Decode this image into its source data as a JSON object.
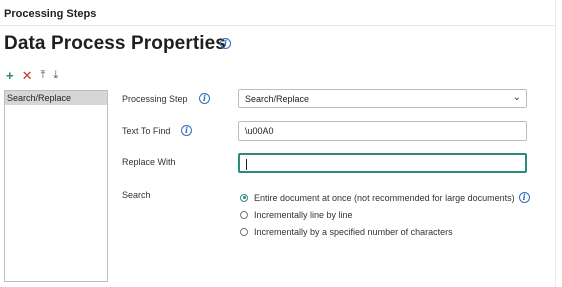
{
  "header": {
    "section_title": "Processing Steps",
    "page_title": "Data Process Properties"
  },
  "toolbar": {
    "add_glyph": "+",
    "delete_glyph": "✕",
    "move_up_glyph": "⤒",
    "move_down_glyph": "⤓"
  },
  "steps": {
    "items": [
      "Search/Replace"
    ],
    "selected": "Search/Replace"
  },
  "form": {
    "processing_step_label": "Processing Step",
    "processing_step_value": "Search/Replace",
    "text_to_find_label": "Text To Find",
    "text_to_find_value": "\\u00A0",
    "replace_with_label": "Replace With",
    "replace_with_value": "",
    "search_label": "Search",
    "search_options": [
      "Entire document at once (not recommended for large documents)",
      "Incrementally line by line",
      "Incrementally by a specified number of characters"
    ],
    "search_selected_index": 0
  },
  "icons": {
    "info": "info-icon",
    "add": "plus-icon",
    "delete": "close-icon",
    "move_up": "move-to-top-icon",
    "move_down": "move-to-bottom-icon",
    "dropdown": "chevron-down-icon"
  },
  "colors": {
    "accent": "#2a8c7c",
    "info_blue": "#2e6fb8",
    "add_green": "#2e8b57",
    "delete_red": "#c0392b",
    "selected_item_bg": "#d6d6d6"
  }
}
